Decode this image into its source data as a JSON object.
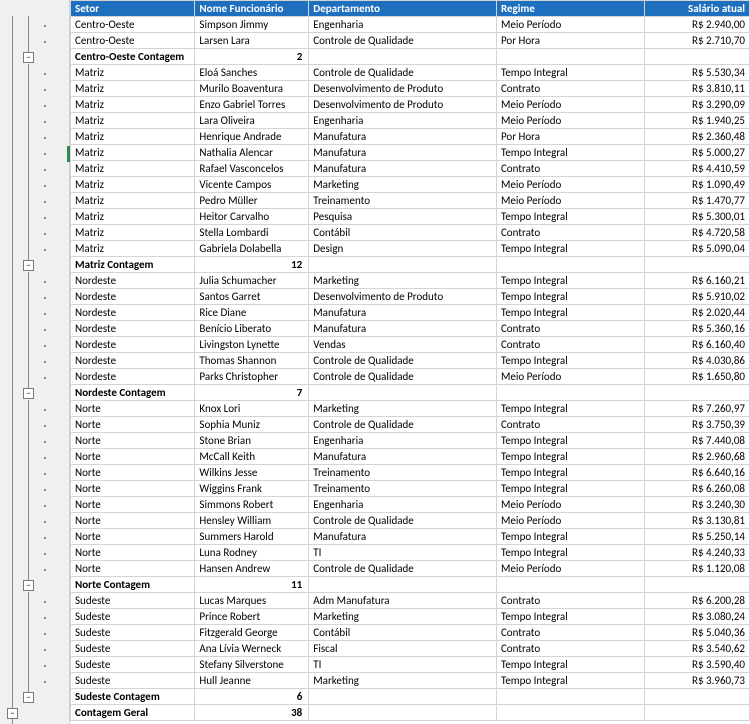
{
  "columns": {
    "setor": "Setor",
    "nome": "Nome Funcionário",
    "departamento": "Departamento",
    "regime": "Regime",
    "salario": "Salário atual"
  },
  "rows": [
    {
      "t": "d",
      "setor": "Centro-Oeste",
      "nome": "Simpson Jimmy",
      "dep": "Engenharia",
      "reg": "Meio Período",
      "sal": "R$ 2.940,00"
    },
    {
      "t": "d",
      "setor": "Centro-Oeste",
      "nome": "Larsen Lara",
      "dep": "Controle de Qualidade",
      "reg": "Por Hora",
      "sal": "R$ 2.710,70"
    },
    {
      "t": "g",
      "label": "Centro-Oeste Contagem",
      "count": "2"
    },
    {
      "t": "d",
      "setor": "Matriz",
      "nome": "Eloá Sanches",
      "dep": "Controle de Qualidade",
      "reg": "Tempo Integral",
      "sal": "R$ 5.530,34"
    },
    {
      "t": "d",
      "setor": "Matriz",
      "nome": "Murilo Boaventura",
      "dep": "Desenvolvimento de Produto",
      "reg": "Contrato",
      "sal": "R$ 3.810,11"
    },
    {
      "t": "d",
      "setor": "Matriz",
      "nome": "Enzo Gabriel Torres",
      "dep": "Desenvolvimento de Produto",
      "reg": "Meio Período",
      "sal": "R$ 3.290,09"
    },
    {
      "t": "d",
      "setor": "Matriz",
      "nome": "Lara Oliveira",
      "dep": "Engenharia",
      "reg": "Meio Período",
      "sal": "R$ 1.940,25"
    },
    {
      "t": "d",
      "setor": "Matriz",
      "nome": "Henrique Andrade",
      "dep": "Manufatura",
      "reg": "Por Hora",
      "sal": "R$ 2.360,48"
    },
    {
      "t": "d",
      "setor": "Matriz",
      "nome": "Nathalia Alencar",
      "dep": "Manufatura",
      "reg": "Tempo Integral",
      "sal": "R$ 5.000,27",
      "mark": true
    },
    {
      "t": "d",
      "setor": "Matriz",
      "nome": "Rafael Vasconcelos",
      "dep": "Manufatura",
      "reg": "Contrato",
      "sal": "R$ 4.410,59"
    },
    {
      "t": "d",
      "setor": "Matriz",
      "nome": "Vicente Campos",
      "dep": "Marketing",
      "reg": "Meio Período",
      "sal": "R$ 1.090,49"
    },
    {
      "t": "d",
      "setor": "Matriz",
      "nome": "Pedro Müller",
      "dep": "Treinamento",
      "reg": "Meio Período",
      "sal": "R$ 1.470,77"
    },
    {
      "t": "d",
      "setor": "Matriz",
      "nome": "Heitor Carvalho",
      "dep": "Pesquisa",
      "reg": "Tempo Integral",
      "sal": "R$ 5.300,01"
    },
    {
      "t": "d",
      "setor": "Matriz",
      "nome": "Stella Lombardi",
      "dep": "Contábil",
      "reg": "Contrato",
      "sal": "R$ 4.720,58"
    },
    {
      "t": "d",
      "setor": "Matriz",
      "nome": "Gabriela Dolabella",
      "dep": "Design",
      "reg": "Tempo Integral",
      "sal": "R$ 5.090,04"
    },
    {
      "t": "g",
      "label": "Matriz Contagem",
      "count": "12"
    },
    {
      "t": "d",
      "setor": "Nordeste",
      "nome": "Julia Schumacher",
      "dep": "Marketing",
      "reg": "Tempo Integral",
      "sal": "R$ 6.160,21"
    },
    {
      "t": "d",
      "setor": "Nordeste",
      "nome": "Santos Garret",
      "dep": "Desenvolvimento de Produto",
      "reg": "Tempo Integral",
      "sal": "R$ 5.910,02"
    },
    {
      "t": "d",
      "setor": "Nordeste",
      "nome": "Rice Diane",
      "dep": "Manufatura",
      "reg": "Tempo Integral",
      "sal": "R$ 2.020,44"
    },
    {
      "t": "d",
      "setor": "Nordeste",
      "nome": "Benício Liberato",
      "dep": "Manufatura",
      "reg": "Contrato",
      "sal": "R$ 5.360,16"
    },
    {
      "t": "d",
      "setor": "Nordeste",
      "nome": "Livingston Lynette",
      "dep": "Vendas",
      "reg": "Contrato",
      "sal": "R$ 6.160,40"
    },
    {
      "t": "d",
      "setor": "Nordeste",
      "nome": "Thomas Shannon",
      "dep": "Controle de Qualidade",
      "reg": "Tempo Integral",
      "sal": "R$ 4.030,86"
    },
    {
      "t": "d",
      "setor": "Nordeste",
      "nome": "Parks Christopher",
      "dep": "Controle de Qualidade",
      "reg": "Meio Período",
      "sal": "R$ 1.650,80"
    },
    {
      "t": "g",
      "label": "Nordeste Contagem",
      "count": "7"
    },
    {
      "t": "d",
      "setor": "Norte",
      "nome": "Knox Lori",
      "dep": "Marketing",
      "reg": "Tempo Integral",
      "sal": "R$ 7.260,97"
    },
    {
      "t": "d",
      "setor": "Norte",
      "nome": "Sophia Muniz",
      "dep": "Controle de Qualidade",
      "reg": "Contrato",
      "sal": "R$ 3.750,39"
    },
    {
      "t": "d",
      "setor": "Norte",
      "nome": "Stone Brian",
      "dep": "Engenharia",
      "reg": "Tempo Integral",
      "sal": "R$ 7.440,08"
    },
    {
      "t": "d",
      "setor": "Norte",
      "nome": "McCall Keith",
      "dep": "Manufatura",
      "reg": "Tempo Integral",
      "sal": "R$ 2.960,68"
    },
    {
      "t": "d",
      "setor": "Norte",
      "nome": "Wilkins Jesse",
      "dep": "Treinamento",
      "reg": "Tempo Integral",
      "sal": "R$ 6.640,16"
    },
    {
      "t": "d",
      "setor": "Norte",
      "nome": "Wiggins Frank",
      "dep": "Treinamento",
      "reg": "Tempo Integral",
      "sal": "R$ 6.260,08"
    },
    {
      "t": "d",
      "setor": "Norte",
      "nome": "Simmons Robert",
      "dep": "Engenharia",
      "reg": "Meio Período",
      "sal": "R$ 3.240,30"
    },
    {
      "t": "d",
      "setor": "Norte",
      "nome": "Hensley William",
      "dep": "Controle de Qualidade",
      "reg": "Meio Período",
      "sal": "R$ 3.130,81"
    },
    {
      "t": "d",
      "setor": "Norte",
      "nome": "Summers Harold",
      "dep": "Manufatura",
      "reg": "Tempo Integral",
      "sal": "R$ 5.250,14"
    },
    {
      "t": "d",
      "setor": "Norte",
      "nome": "Luna Rodney",
      "dep": "TI",
      "reg": "Tempo Integral",
      "sal": "R$ 4.240,33"
    },
    {
      "t": "d",
      "setor": "Norte",
      "nome": "Hansen Andrew",
      "dep": "Controle de Qualidade",
      "reg": "Meio Período",
      "sal": "R$ 1.120,08"
    },
    {
      "t": "g",
      "label": "Norte Contagem",
      "count": "11"
    },
    {
      "t": "d",
      "setor": "Sudeste",
      "nome": "Lucas Marques",
      "dep": "Adm Manufatura",
      "reg": "Contrato",
      "sal": "R$ 6.200,28"
    },
    {
      "t": "d",
      "setor": "Sudeste",
      "nome": "Prince Robert",
      "dep": "Marketing",
      "reg": "Tempo Integral",
      "sal": "R$ 3.080,24"
    },
    {
      "t": "d",
      "setor": "Sudeste",
      "nome": "Fitzgerald George",
      "dep": "Contábil",
      "reg": "Contrato",
      "sal": "R$ 5.040,36"
    },
    {
      "t": "d",
      "setor": "Sudeste",
      "nome": "Ana Lívia Werneck",
      "dep": "Fiscal",
      "reg": "Contrato",
      "sal": "R$ 3.540,62"
    },
    {
      "t": "d",
      "setor": "Sudeste",
      "nome": "Stefany Silverstone",
      "dep": "TI",
      "reg": "Tempo Integral",
      "sal": "R$ 3.590,40"
    },
    {
      "t": "d",
      "setor": "Sudeste",
      "nome": "Hull Jeanne",
      "dep": "Marketing",
      "reg": "Tempo Integral",
      "sal": "R$ 3.960,73"
    },
    {
      "t": "g",
      "label": "Sudeste Contagem",
      "count": "6"
    },
    {
      "t": "t",
      "label": "Contagem Geral",
      "count": "38"
    }
  ]
}
